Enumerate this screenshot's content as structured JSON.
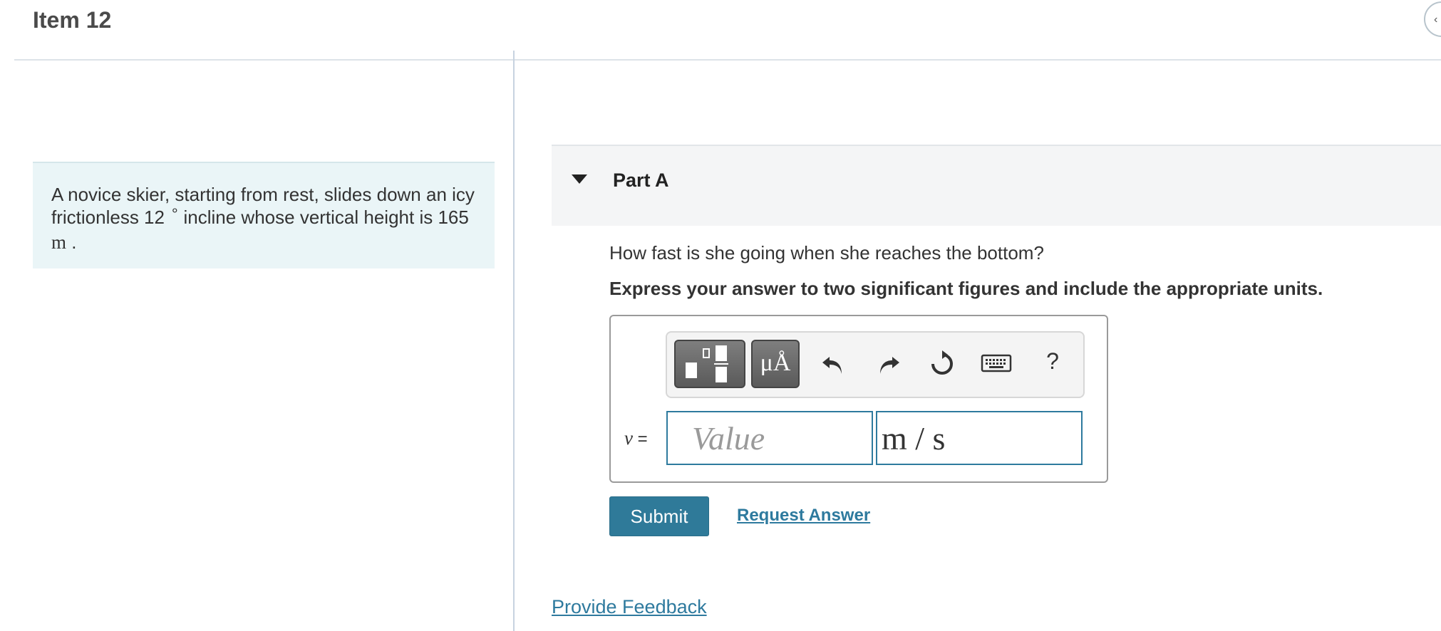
{
  "header": {
    "title": "Item 12",
    "collapse_icon": "chevron-left-icon"
  },
  "problem": {
    "text_1": "A novice skier, starting from rest, slides down an icy",
    "text_2a": "frictionless 12",
    "degree_symbol": "∘",
    "text_2b": "incline whose vertical height is 165",
    "unit": "m",
    "end": "."
  },
  "part": {
    "title": "Part A",
    "caret_icon": "caret-down-icon",
    "question": "How fast is she going when she reaches the bottom?",
    "instruction": "Express your answer to two significant figures and include the appropriate units."
  },
  "toolbar": {
    "template_icon": "fraction-template-icon",
    "units_label": "μÅ",
    "undo_icon": "undo-icon",
    "redo_icon": "redo-icon",
    "reset_icon": "reset-icon",
    "keyboard_icon": "keyboard-icon",
    "help_label": "?"
  },
  "answer": {
    "variable": "v",
    "equals": "=",
    "value_placeholder": "Value",
    "value": "",
    "units_value": "m / s"
  },
  "actions": {
    "submit_label": "Submit",
    "request_answer_label": "Request Answer"
  },
  "footer": {
    "feedback_label": "Provide Feedback"
  },
  "colors": {
    "accent": "#2f7a99",
    "problem_bg": "#eaf5f7",
    "part_header_bg": "#f4f5f6"
  }
}
